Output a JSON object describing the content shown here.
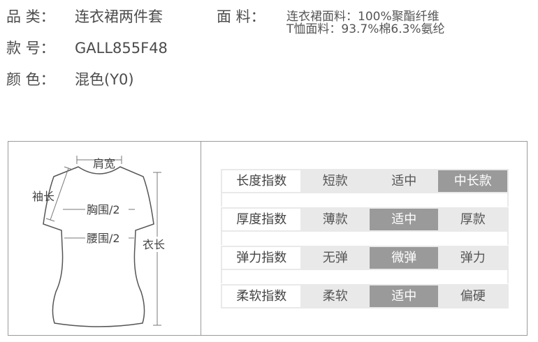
{
  "product": {
    "category_label": "品 类：",
    "category_value": "连衣裙两件套",
    "material_label": "面 料：",
    "material_lines": [
      "连衣裙面料：100%聚酯纤维",
      "T恤面料：93.7%棉6.3%氨纶"
    ],
    "style_no_label": "款 号：",
    "style_no_value": "GALL855F48",
    "color_label": "颜 色：",
    "color_value": "混色(Y0)"
  },
  "measure_figure": {
    "shoulder_label": "肩宽",
    "sleeve_label": "袖长",
    "chest_label": "胸围/2",
    "waist_label": "腰围/2",
    "length_label": "衣长"
  },
  "indices": [
    {
      "name": "长度指数",
      "options": [
        "短款",
        "适中",
        "中长款"
      ],
      "selected": 2
    },
    {
      "name": "厚度指数",
      "options": [
        "薄款",
        "适中",
        "厚款"
      ],
      "selected": 1
    },
    {
      "name": "弹力指数",
      "options": [
        "无弹",
        "微弹",
        "弹力"
      ],
      "selected": 1
    },
    {
      "name": "柔软指数",
      "options": [
        "柔软",
        "适中",
        "偏硬"
      ],
      "selected": 1
    }
  ],
  "colors": {
    "selected_bg": "#9a9a9a",
    "cell_bg": "#e9e9e9",
    "text": "#4c4c4c"
  }
}
